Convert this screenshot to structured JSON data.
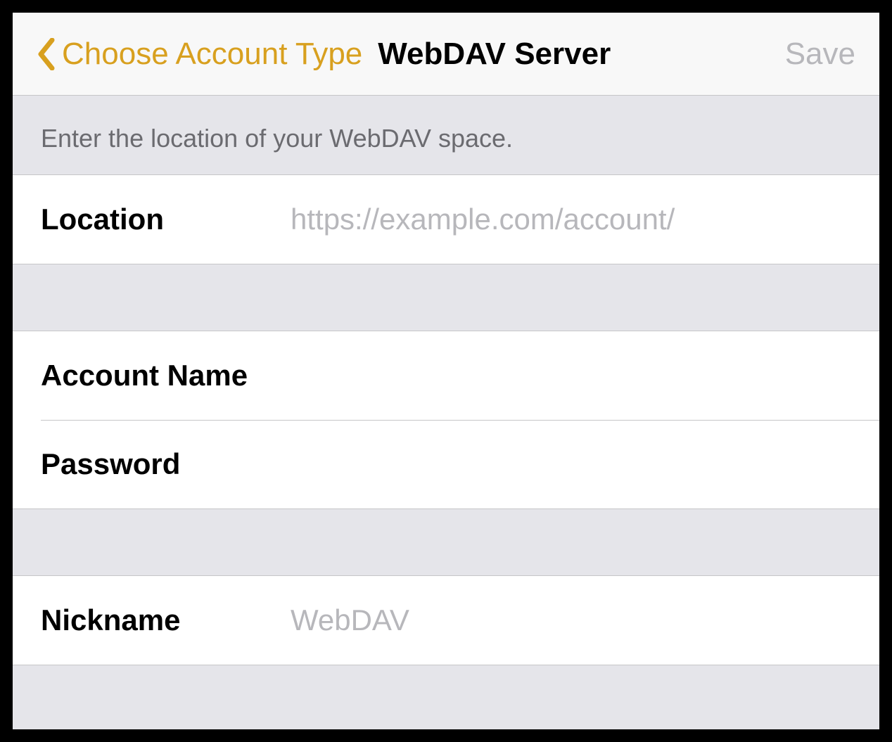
{
  "nav": {
    "back_label": "Choose Account Type",
    "title": "WebDAV Server",
    "save_label": "Save"
  },
  "section": {
    "header": "Enter the location of your WebDAV space."
  },
  "fields": {
    "location": {
      "label": "Location",
      "placeholder": "https://example.com/account/",
      "value": ""
    },
    "account_name": {
      "label": "Account Name",
      "placeholder": "",
      "value": ""
    },
    "password": {
      "label": "Password",
      "placeholder": "",
      "value": ""
    },
    "nickname": {
      "label": "Nickname",
      "placeholder": "WebDAV",
      "value": ""
    }
  },
  "colors": {
    "accent": "#d8a01f",
    "disabled": "#b7b7bb",
    "header_bg": "#f8f8f8",
    "group_bg": "#e5e5ea",
    "separator": "#c6c6c8"
  }
}
